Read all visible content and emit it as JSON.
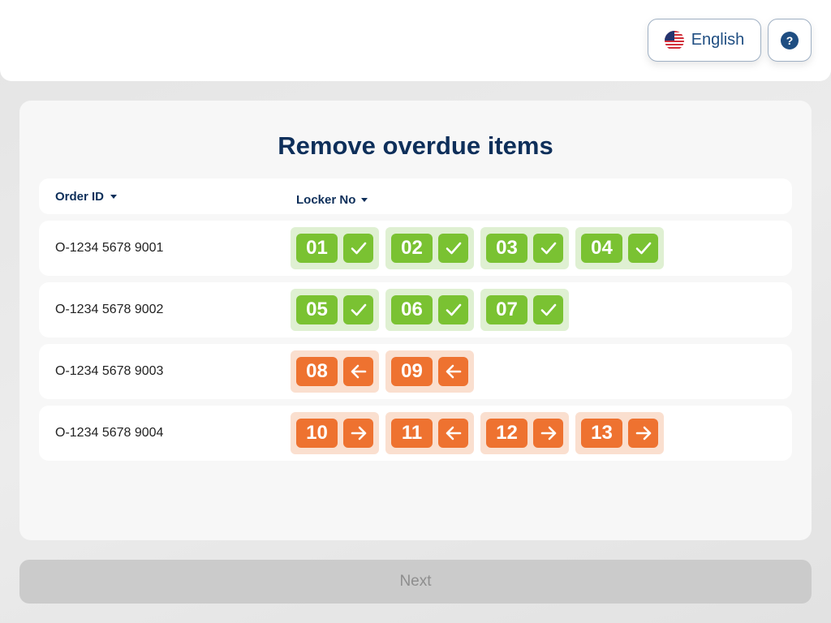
{
  "header": {
    "language_label": "English",
    "language_icon": "us-flag-icon",
    "help_icon": "question-mark-icon",
    "help_glyph": "?"
  },
  "main": {
    "title": "Remove overdue items",
    "columns": [
      {
        "label": "Order ID"
      },
      {
        "label": "Locker No"
      }
    ],
    "rows": [
      {
        "order_id": "O-1234 5678 9001",
        "lockers": [
          {
            "no": "01",
            "status": "done",
            "icon": "check-icon"
          },
          {
            "no": "02",
            "status": "done",
            "icon": "check-icon"
          },
          {
            "no": "03",
            "status": "done",
            "icon": "check-icon"
          },
          {
            "no": "04",
            "status": "done",
            "icon": "check-icon"
          }
        ]
      },
      {
        "order_id": "O-1234 5678 9002",
        "lockers": [
          {
            "no": "05",
            "status": "done",
            "icon": "check-icon"
          },
          {
            "no": "06",
            "status": "done",
            "icon": "check-icon"
          },
          {
            "no": "07",
            "status": "done",
            "icon": "check-icon"
          }
        ]
      },
      {
        "order_id": "O-1234 5678 9003",
        "lockers": [
          {
            "no": "08",
            "status": "pending",
            "icon": "arrow-left-icon"
          },
          {
            "no": "09",
            "status": "pending",
            "icon": "arrow-left-icon"
          }
        ]
      },
      {
        "order_id": "O-1234 5678 9004",
        "lockers": [
          {
            "no": "10",
            "status": "pending",
            "icon": "arrow-right-icon"
          },
          {
            "no": "11",
            "status": "pending",
            "icon": "arrow-left-icon"
          },
          {
            "no": "12",
            "status": "pending",
            "icon": "arrow-right-icon"
          },
          {
            "no": "13",
            "status": "pending",
            "icon": "arrow-right-icon"
          }
        ]
      }
    ]
  },
  "footer": {
    "next_label": "Next",
    "next_enabled": false
  },
  "colors": {
    "primary": "#0e2f5a",
    "done": "#7ac232",
    "done_bg": "#dff0d2",
    "pending": "#ee7230",
    "pending_bg": "#fadfcf",
    "disabled": "#cbcbcb"
  }
}
